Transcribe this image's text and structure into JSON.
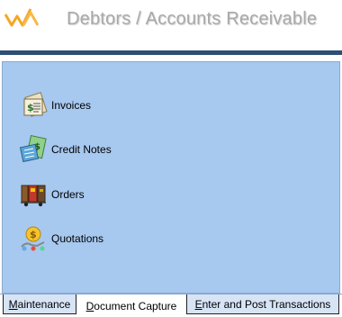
{
  "header": {
    "title": "Debtors / Accounts Receivable"
  },
  "menu": [
    {
      "label": "Invoices",
      "icon": "invoice-icon"
    },
    {
      "label": "Credit Notes",
      "icon": "credit-note-icon"
    },
    {
      "label": "Orders",
      "icon": "orders-icon"
    },
    {
      "label": "Quotations",
      "icon": "quotations-icon"
    }
  ],
  "tabs": [
    {
      "first": "M",
      "rest": "aintenance",
      "active": false
    },
    {
      "first": "D",
      "rest": "ocument Capture",
      "active": true
    },
    {
      "first": "E",
      "rest": "nter and Post Transactions",
      "active": false
    }
  ],
  "colors": {
    "panel_bg": "#a7c8ef",
    "header_rule": "#2e4e73",
    "title": "#a9a9a9",
    "logo": "#f5a623"
  }
}
